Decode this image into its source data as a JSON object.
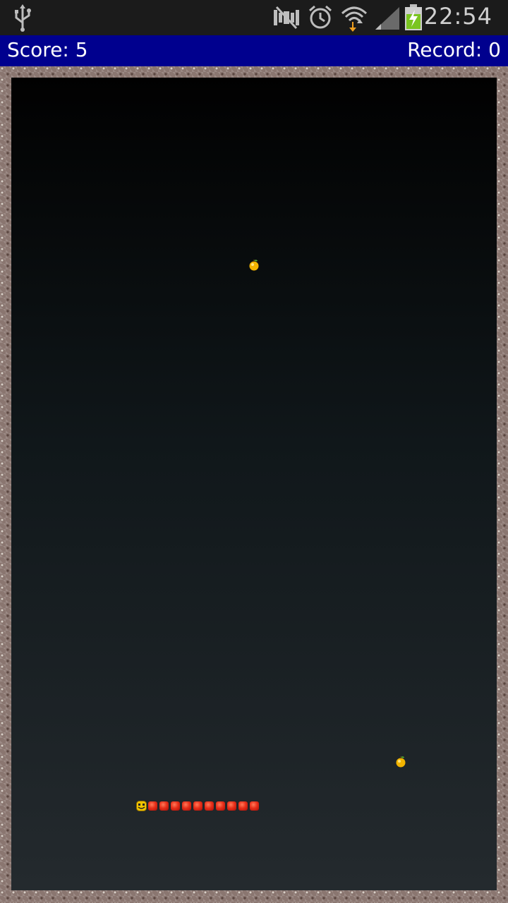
{
  "status_bar": {
    "time": "22:54",
    "icons": [
      "usb-icon",
      "mute-icon",
      "alarm-icon",
      "wifi-icon",
      "signal-icon",
      "battery-charging-icon"
    ]
  },
  "score_bar": {
    "score": "Score: 5",
    "record": "Record: 0",
    "background": "#00008e"
  },
  "game": {
    "apples": 2,
    "snake_segments": 10,
    "wall_color": "#8a7670"
  }
}
